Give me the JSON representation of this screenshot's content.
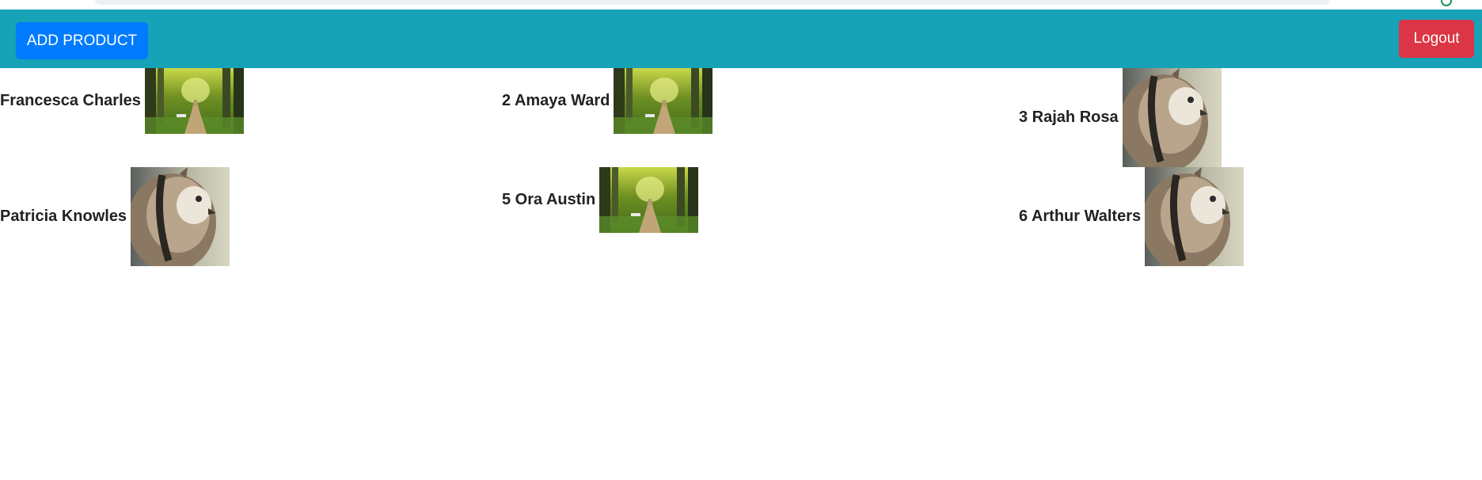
{
  "toolbar": {
    "add_label": "ADD PRODUCT",
    "logout_label": "Logout"
  },
  "colors": {
    "navbar": "#17a2b8",
    "add_button": "#007bff",
    "logout_button": "#dc3545",
    "text": "#222222"
  },
  "products": [
    {
      "label": "Francesca Charles",
      "image": "forest-path-image"
    },
    {
      "label": "2 Amaya Ward",
      "image": "forest-path-image"
    },
    {
      "label": "3 Rajah Rosa",
      "image": "owl-image"
    },
    {
      "label": "Patricia Knowles",
      "image": "owl-image"
    },
    {
      "label": "5 Ora Austin",
      "image": "forest-path-image"
    },
    {
      "label": "6 Arthur Walters",
      "image": "owl-image"
    }
  ]
}
